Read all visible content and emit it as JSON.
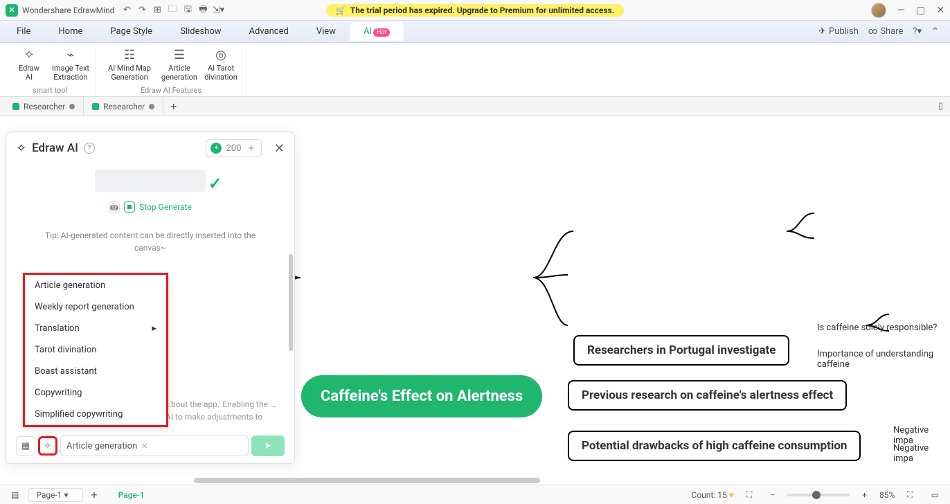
{
  "app": {
    "name": "Wondershare EdrawMind"
  },
  "trial_banner": "The trial period has expired. Upgrade to Premium for unlimited access.",
  "menu": {
    "items": [
      "File",
      "Home",
      "Page Style",
      "Slideshow",
      "Advanced",
      "View",
      "AI"
    ],
    "hot": "Hot",
    "publish": "Publish",
    "share": "Share"
  },
  "ribbon": {
    "group1": {
      "label": "smart tool",
      "btns": [
        {
          "l1": "Edraw",
          "l2": "AI"
        },
        {
          "l1": "Image Text",
          "l2": "Extraction"
        }
      ]
    },
    "group2": {
      "label": "Edraw AI Features",
      "btns": [
        {
          "l1": "AI Mind Map",
          "l2": "Generation"
        },
        {
          "l1": "Article",
          "l2": "generation"
        },
        {
          "l1": "AI Tarot",
          "l2": "divination"
        }
      ]
    }
  },
  "doc_tabs": [
    "Researcher",
    "Researcher"
  ],
  "ai_panel": {
    "title": "Edraw AI",
    "credits": "200",
    "stop": "Stop Generate",
    "tip": "Tip: AI-generated content can be directly inserted into the canvas~",
    "popup": [
      "Article generation",
      "Weekly report generation",
      "Translation",
      "Tarot divination",
      "Boast assistant",
      "Copywriting",
      "Simplified copywriting"
    ],
    "backdrop": "…bout the app.' Enabling the … AI to make adjustments to",
    "input_chip": "Article generation"
  },
  "mindmap": {
    "root": "Caffeine's Effect on Alertness",
    "branches": [
      {
        "label": "Researchers in Portugal investigate",
        "leaves": [
          "Is caffeine solely responsible?",
          "Importance of understanding caffeine"
        ]
      },
      {
        "label": "Previous research on caffeine's alertness effect",
        "leaves": []
      },
      {
        "label": "Potential drawbacks of high caffeine consumption",
        "leaves": [
          "Negative impa",
          "Negative impa"
        ]
      }
    ]
  },
  "status": {
    "page_sel": "Page-1",
    "page_active": "Page-1",
    "count_label": "Count:",
    "count": "15",
    "zoom": "85%"
  }
}
